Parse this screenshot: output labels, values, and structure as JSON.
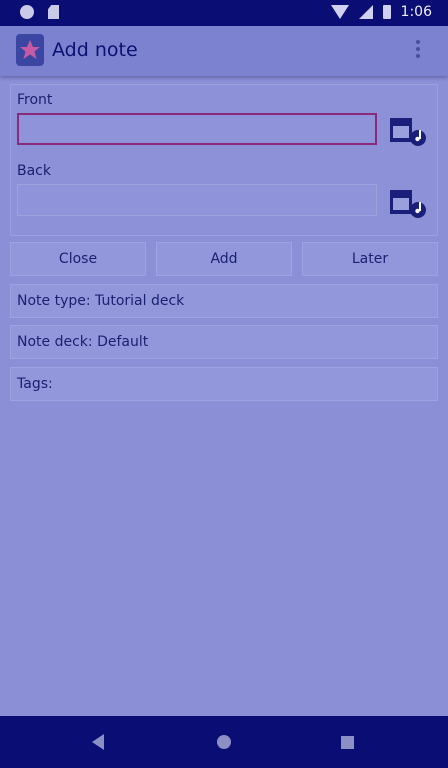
{
  "status_bar": {
    "time": "1:06",
    "icons": [
      "circle-notification-icon",
      "sd-card-icon",
      "wifi-icon",
      "signal-icon",
      "battery-icon"
    ]
  },
  "app_bar": {
    "title": "Add note",
    "app_icon": "anki-star-icon",
    "menu_icon": "overflow-menu-icon"
  },
  "fields": {
    "front": {
      "label": "Front",
      "value": ""
    },
    "back": {
      "label": "Back",
      "value": ""
    },
    "media_icon": "media-attach-icon"
  },
  "buttons": {
    "close": "Close",
    "add": "Add",
    "later": "Later"
  },
  "rows": {
    "note_type": "Note type: Tutorial deck",
    "note_deck": "Note deck: Default",
    "tags": "Tags:"
  },
  "nav_bar": {
    "icons": [
      "back-icon",
      "home-icon",
      "recents-icon"
    ]
  },
  "colors": {
    "status_bar": "#0a0e74",
    "app_bar": "#7d82d0",
    "background": "#8a8fd6",
    "focused_border": "#8a2a7a"
  }
}
